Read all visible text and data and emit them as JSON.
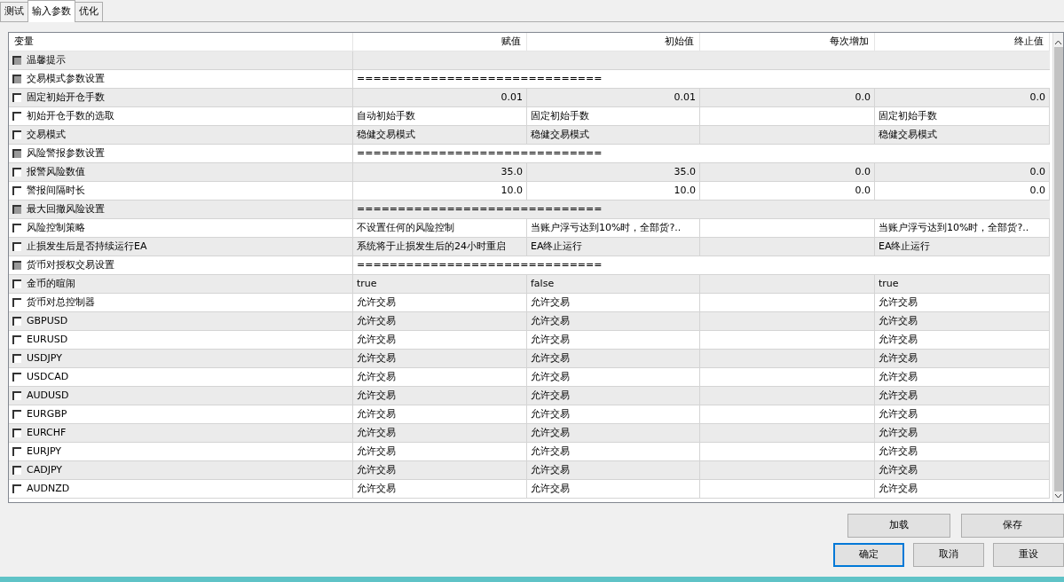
{
  "tabs": [
    {
      "label": "测试",
      "selected": false
    },
    {
      "label": "输入参数",
      "selected": true
    },
    {
      "label": "优化",
      "selected": false
    }
  ],
  "table": {
    "columns": [
      "变量",
      "赋值",
      "初始值",
      "每次增加",
      "终止值"
    ],
    "rows": [
      {
        "kind": "group",
        "name": "温馨提示"
      },
      {
        "kind": "group",
        "name": "交易模式参数设置",
        "value": "=============================="
      },
      {
        "kind": "number",
        "name": "固定初始开仓手数",
        "value": "0.01",
        "start": "0.01",
        "step": "0.0",
        "stop": "0.0"
      },
      {
        "kind": "text",
        "name": "初始开仓手数的选取",
        "value": "自动初始手数",
        "start": "固定初始手数",
        "stop": "固定初始手数"
      },
      {
        "kind": "text",
        "name": "交易模式",
        "value": "稳健交易模式",
        "start": "稳健交易模式",
        "stop": "稳健交易模式"
      },
      {
        "kind": "group",
        "name": "风险警报参数设置",
        "value": "=============================="
      },
      {
        "kind": "number",
        "name": "报警风险数值",
        "value": "35.0",
        "start": "35.0",
        "step": "0.0",
        "stop": "0.0"
      },
      {
        "kind": "number",
        "name": "警报间隔时长",
        "value": "10.0",
        "start": "10.0",
        "step": "0.0",
        "stop": "0.0"
      },
      {
        "kind": "group",
        "name": "最大回撤风险设置",
        "value": "=============================="
      },
      {
        "kind": "text",
        "name": "风险控制策略",
        "value": "不设置任何的风险控制",
        "start": "当账户浮亏达到10%时，全部货?..",
        "stop": "当账户浮亏达到10%时，全部货?.."
      },
      {
        "kind": "text",
        "name": "止损发生后是否持续运行EA",
        "value": "系统将于止损发生后的24小时重启",
        "start": "EA终止运行",
        "stop": "EA终止运行"
      },
      {
        "kind": "group",
        "name": "货币对授权交易设置",
        "value": "=============================="
      },
      {
        "kind": "text",
        "name": "金币的暄闹",
        "value": "true",
        "start": "false",
        "stop": "true"
      },
      {
        "kind": "text",
        "name": "货币对总控制器",
        "value": "允许交易",
        "start": "允许交易",
        "stop": "允许交易"
      },
      {
        "kind": "text",
        "name": "GBPUSD",
        "value": "允许交易",
        "start": "允许交易",
        "stop": "允许交易"
      },
      {
        "kind": "text",
        "name": "EURUSD",
        "value": "允许交易",
        "start": "允许交易",
        "stop": "允许交易"
      },
      {
        "kind": "text",
        "name": "USDJPY",
        "value": "允许交易",
        "start": "允许交易",
        "stop": "允许交易"
      },
      {
        "kind": "text",
        "name": "USDCAD",
        "value": "允许交易",
        "start": "允许交易",
        "stop": "允许交易"
      },
      {
        "kind": "text",
        "name": "AUDUSD",
        "value": "允许交易",
        "start": "允许交易",
        "stop": "允许交易"
      },
      {
        "kind": "text",
        "name": "EURGBP",
        "value": "允许交易",
        "start": "允许交易",
        "stop": "允许交易"
      },
      {
        "kind": "text",
        "name": "EURCHF",
        "value": "允许交易",
        "start": "允许交易",
        "stop": "允许交易"
      },
      {
        "kind": "text",
        "name": "EURJPY",
        "value": "允许交易",
        "start": "允许交易",
        "stop": "允许交易"
      },
      {
        "kind": "text",
        "name": "CADJPY",
        "value": "允许交易",
        "start": "允许交易",
        "stop": "允许交易"
      },
      {
        "kind": "text",
        "name": "AUDNZD",
        "value": "允许交易",
        "start": "允许交易",
        "stop": "允许交易"
      }
    ]
  },
  "button_rows": [
    [
      {
        "label": "加载",
        "default": false
      },
      {
        "label": "保存",
        "default": false
      }
    ],
    [
      {
        "label": "确定",
        "default": true
      },
      {
        "label": "取消",
        "default": false
      },
      {
        "label": "重设",
        "default": false
      }
    ]
  ]
}
